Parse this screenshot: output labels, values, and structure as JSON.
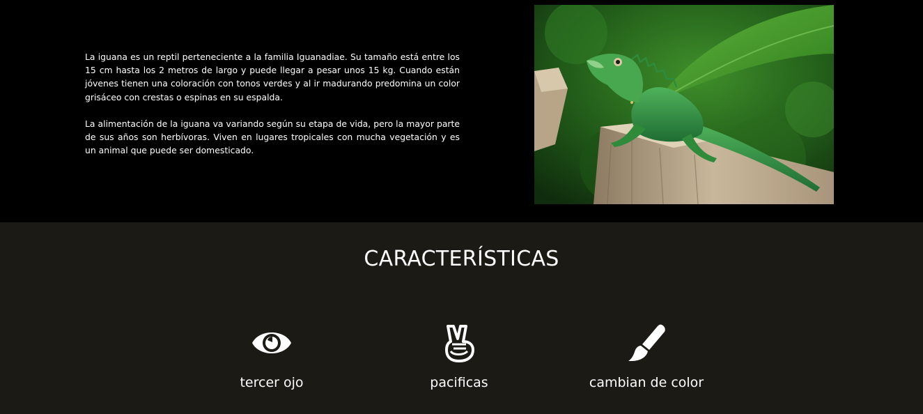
{
  "intro": {
    "paragraphs": [
      "La iguana es un reptil perteneciente a la familia Iguanadiae. Su tamaño está entre los 15 cm hasta los 2 metros de largo y puede llegar a pesar unos 15 kg. Cuando están jóvenes tienen una coloración con tonos verdes y al ir madurando predomina un color grisáceo con crestas o espinas en su espalda.",
      "La alimentación de la iguana va variando según su etapa de vida, pero la mayor parte de sus años son herbívoras. Viven en lugares tropicales con mucha vegetación y es un animal que puede ser domesticado."
    ]
  },
  "photo": {
    "subject": "green iguana on a tree stump"
  },
  "features": {
    "title": "CARACTERÍSTICAS",
    "items": [
      {
        "label": "tercer ojo",
        "icon": "eye-icon"
      },
      {
        "label": "pacificas",
        "icon": "peace-hand-icon"
      },
      {
        "label": "cambian de color",
        "icon": "paintbrush-icon"
      }
    ]
  },
  "colors": {
    "top_background": "#000000",
    "features_background": "#1c1a15",
    "text": "#ffffff"
  }
}
